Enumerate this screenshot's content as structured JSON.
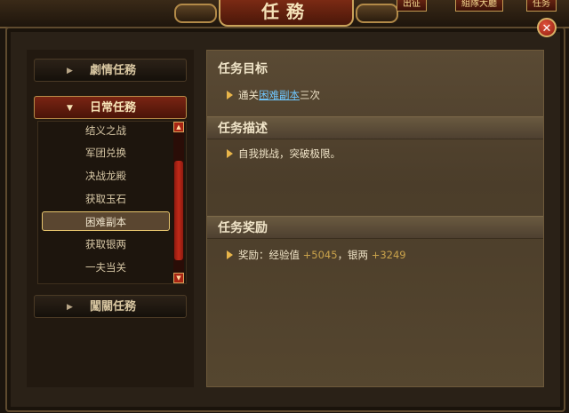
{
  "window": {
    "title": "任務"
  },
  "topbar": {
    "btn_out": "出征",
    "btn_team": "組隊大廳",
    "btn_right": "任务"
  },
  "left": {
    "categories": [
      {
        "label": "劇情任務",
        "arrow": "▶"
      },
      {
        "label": "日常任務",
        "arrow": "▼"
      },
      {
        "label": "闖關任務",
        "arrow": "▶"
      }
    ],
    "daily_items": [
      "结义之战",
      "军团兑换",
      "决战龙殿",
      "获取玉石",
      "困难副本",
      "获取银两",
      "一夫当关"
    ],
    "selected_item": "困难副本",
    "scroll": {
      "up": "▲",
      "down": "▼"
    }
  },
  "right": {
    "goal_title": "任务目标",
    "goal_prefix": "通关",
    "goal_link": "困难副本",
    "goal_suffix": "三次",
    "desc_title": "任务描述",
    "desc_text": "自我挑战，突破极限。",
    "reward_title": "任务奖励",
    "reward_prefix": "奖励：经验值",
    "reward_exp": "+5045",
    "reward_mid": "，银两",
    "reward_silver": "+3249"
  },
  "close_label": "✕"
}
